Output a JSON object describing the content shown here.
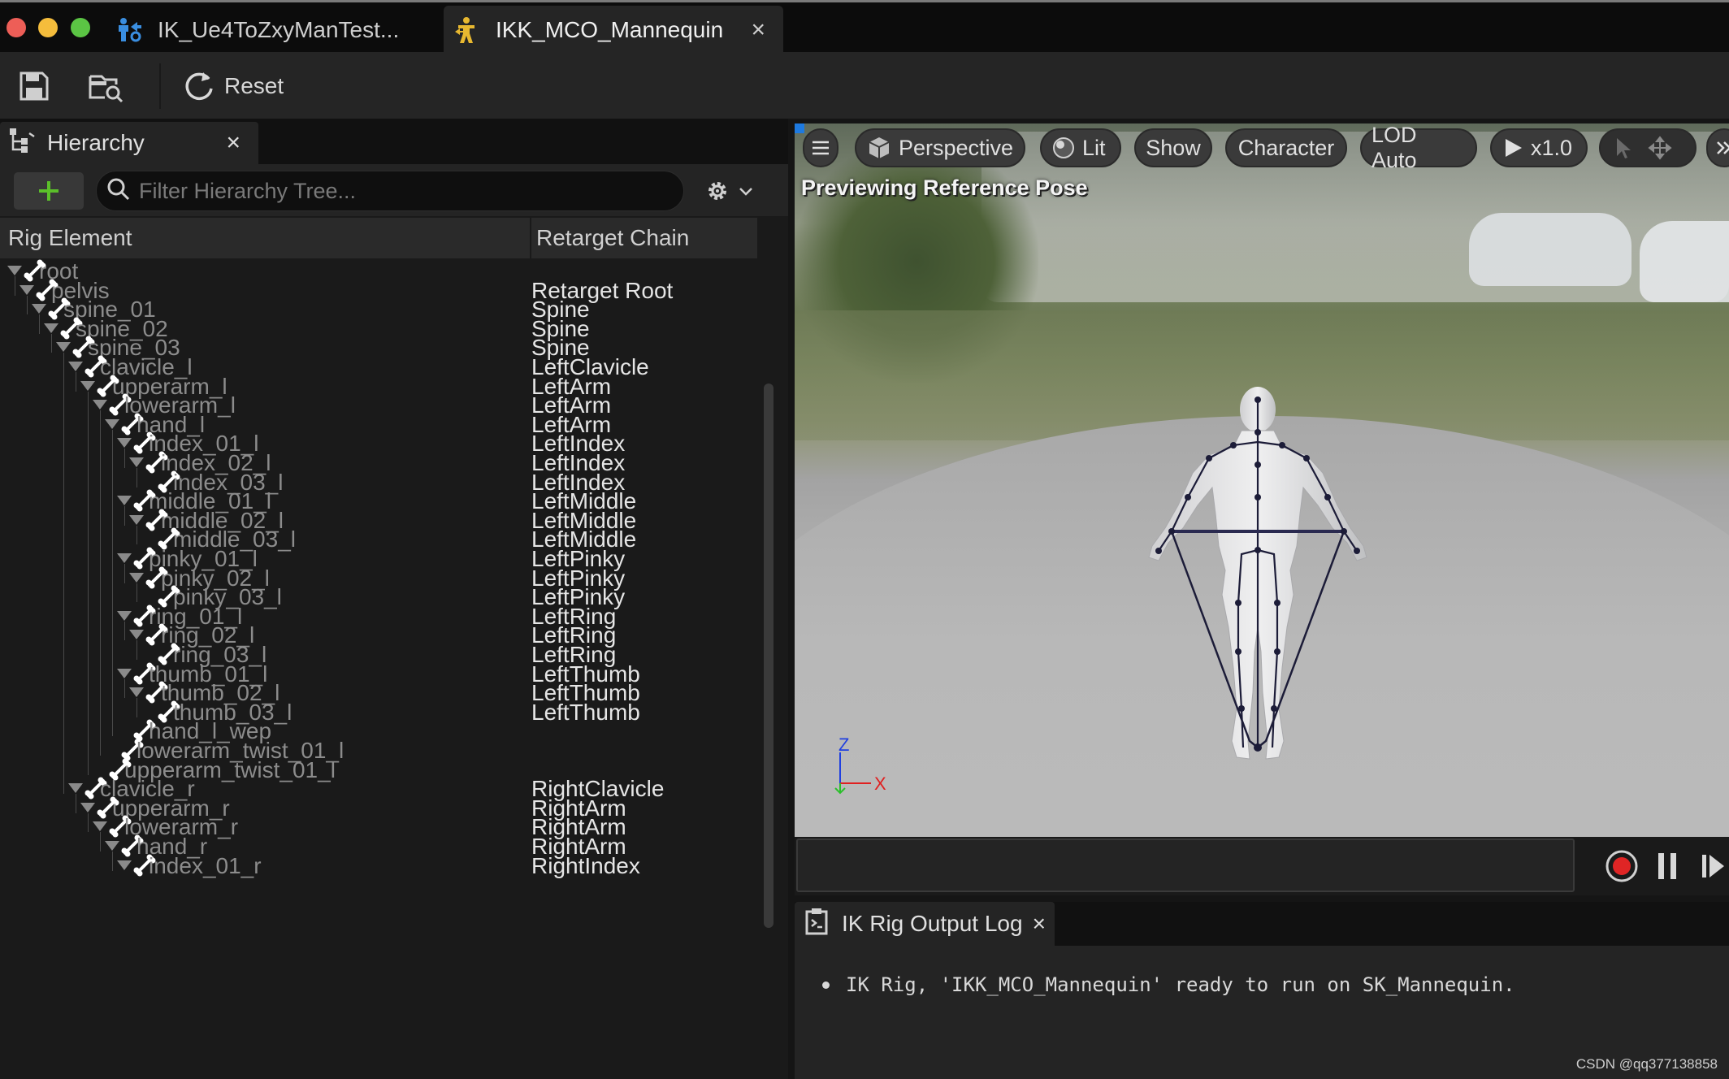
{
  "window": {
    "tabs": [
      {
        "label": "IK_Ue4ToZxyManTest...",
        "active": false,
        "icon": "retargeter-icon"
      },
      {
        "label": "IKK_MCO_Mannequin",
        "active": true,
        "icon": "ik-rig-icon"
      }
    ],
    "close_glyph": "×"
  },
  "toolbar": {
    "save_icon": "save-icon",
    "browse_icon": "browse-asset-icon",
    "reset_label": "Reset"
  },
  "hierarchy": {
    "tab_label": "Hierarchy",
    "search_placeholder": "Filter Hierarchy Tree...",
    "col_rig_element": "Rig Element",
    "col_retarget_chain": "Retarget Chain",
    "rows": [
      {
        "name": "root",
        "depth": 0,
        "expanded": true,
        "chain": ""
      },
      {
        "name": "pelvis",
        "depth": 1,
        "expanded": true,
        "chain": "Retarget Root"
      },
      {
        "name": "spine_01",
        "depth": 2,
        "expanded": true,
        "chain": "Spine"
      },
      {
        "name": "spine_02",
        "depth": 3,
        "expanded": true,
        "chain": "Spine"
      },
      {
        "name": "spine_03",
        "depth": 4,
        "expanded": true,
        "chain": "Spine"
      },
      {
        "name": "clavicle_l",
        "depth": 5,
        "expanded": true,
        "chain": "LeftClavicle"
      },
      {
        "name": "upperarm_l",
        "depth": 6,
        "expanded": true,
        "chain": "LeftArm"
      },
      {
        "name": "lowerarm_l",
        "depth": 7,
        "expanded": true,
        "chain": "LeftArm"
      },
      {
        "name": "hand_l",
        "depth": 8,
        "expanded": true,
        "chain": "LeftArm"
      },
      {
        "name": "index_01_l",
        "depth": 9,
        "expanded": true,
        "chain": "LeftIndex"
      },
      {
        "name": "index_02_l",
        "depth": 10,
        "expanded": true,
        "chain": "LeftIndex"
      },
      {
        "name": "index_03_l",
        "depth": 11,
        "expanded": false,
        "chain": "LeftIndex"
      },
      {
        "name": "middle_01_l",
        "depth": 9,
        "expanded": true,
        "chain": "LeftMiddle"
      },
      {
        "name": "middle_02_l",
        "depth": 10,
        "expanded": true,
        "chain": "LeftMiddle"
      },
      {
        "name": "middle_03_l",
        "depth": 11,
        "expanded": false,
        "chain": "LeftMiddle"
      },
      {
        "name": "pinky_01_l",
        "depth": 9,
        "expanded": true,
        "chain": "LeftPinky"
      },
      {
        "name": "pinky_02_l",
        "depth": 10,
        "expanded": true,
        "chain": "LeftPinky"
      },
      {
        "name": "pinky_03_l",
        "depth": 11,
        "expanded": false,
        "chain": "LeftPinky"
      },
      {
        "name": "ring_01_l",
        "depth": 9,
        "expanded": true,
        "chain": "LeftRing"
      },
      {
        "name": "ring_02_l",
        "depth": 10,
        "expanded": true,
        "chain": "LeftRing"
      },
      {
        "name": "ring_03_l",
        "depth": 11,
        "expanded": false,
        "chain": "LeftRing"
      },
      {
        "name": "thumb_01_l",
        "depth": 9,
        "expanded": true,
        "chain": "LeftThumb"
      },
      {
        "name": "thumb_02_l",
        "depth": 10,
        "expanded": true,
        "chain": "LeftThumb"
      },
      {
        "name": "thumb_03_l",
        "depth": 11,
        "expanded": false,
        "chain": "LeftThumb"
      },
      {
        "name": "hand_l_wep",
        "depth": 9,
        "expanded": false,
        "chain": ""
      },
      {
        "name": "lowerarm_twist_01_l",
        "depth": 8,
        "expanded": false,
        "chain": ""
      },
      {
        "name": "upperarm_twist_01_l",
        "depth": 7,
        "expanded": false,
        "chain": ""
      },
      {
        "name": "clavicle_r",
        "depth": 5,
        "expanded": true,
        "chain": "RightClavicle"
      },
      {
        "name": "upperarm_r",
        "depth": 6,
        "expanded": true,
        "chain": "RightArm"
      },
      {
        "name": "lowerarm_r",
        "depth": 7,
        "expanded": true,
        "chain": "RightArm"
      },
      {
        "name": "hand_r",
        "depth": 8,
        "expanded": true,
        "chain": "RightArm"
      },
      {
        "name": "index_01_r",
        "depth": 9,
        "expanded": true,
        "chain": "RightIndex"
      }
    ]
  },
  "viewport": {
    "view_mode": "Perspective",
    "lighting": "Lit",
    "show": "Show",
    "character": "Character",
    "lod": "LOD Auto",
    "speed": "x1.0",
    "status": "Previewing Reference Pose",
    "axis_z": "Z",
    "axis_x": "X",
    "colors": {
      "axis_x": "#e02020",
      "axis_y": "#2ac02a",
      "axis_z": "#2040e0"
    }
  },
  "log": {
    "tab_label": "IK Rig Output Log",
    "line": "IK Rig, 'IKK_MCO_Mannequin' ready to run on SK_Mannequin."
  },
  "watermark": "CSDN @qq377138858",
  "colors": {
    "add_plus": "#5bbf2a",
    "record": "#e02525"
  }
}
